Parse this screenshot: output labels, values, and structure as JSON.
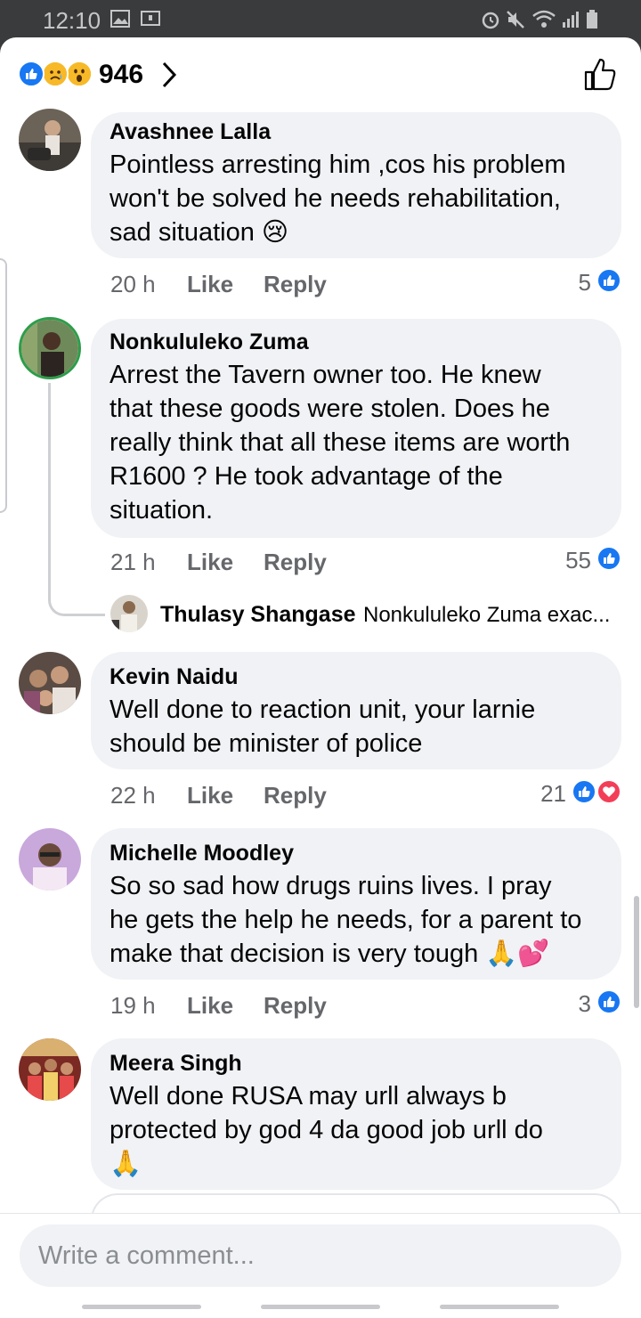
{
  "status_bar": {
    "time": "12:10"
  },
  "reactions": {
    "count": "946",
    "icons": [
      "like-icon",
      "sad-icon",
      "wow-icon"
    ]
  },
  "comments": [
    {
      "author": "Avashnee Lalla",
      "text": "Pointless arresting him ,cos his problem\nwon't be solved he needs rehabilitation,\nsad situation 😢",
      "time": "20 h",
      "like": "Like",
      "reply": "Reply",
      "reaction_count": "5"
    },
    {
      "author": "Nonkululeko Zuma",
      "text": "Arrest the Tavern owner too. He knew\nthat these goods were stolen. Does he\nreally think that all these items are worth\nR1600 ? He took advantage of the\nsituation.",
      "time": "21 h",
      "like": "Like",
      "reply": "Reply",
      "reaction_count": "55",
      "reply_preview": {
        "author": "Thulasy Shangase",
        "text": "Nonkululeko Zuma exac..."
      }
    },
    {
      "author": "Kevin Naidu",
      "text": "Well done to reaction unit, your larnie\nshould be minister of police",
      "time": "22 h",
      "like": "Like",
      "reply": "Reply",
      "reaction_count": "21"
    },
    {
      "author": "Michelle Moodley",
      "text": "So so sad how drugs ruins lives. I pray\nhe gets the help he needs, for a parent to\nmake that decision is very tough 🙏💕",
      "time": "19 h",
      "like": "Like",
      "reply": "Reply",
      "reaction_count": "3"
    },
    {
      "author": "Meera Singh",
      "text": "Well done RUSA may urll always b\nprotected by god 4 da good job urll do\n🙏"
    }
  ],
  "composer": {
    "placeholder": "Write a comment..."
  },
  "colors": {
    "accent": "#1877f2",
    "love": "#f33e58",
    "bubble": "#f0f2f5",
    "meta": "#65676b"
  }
}
